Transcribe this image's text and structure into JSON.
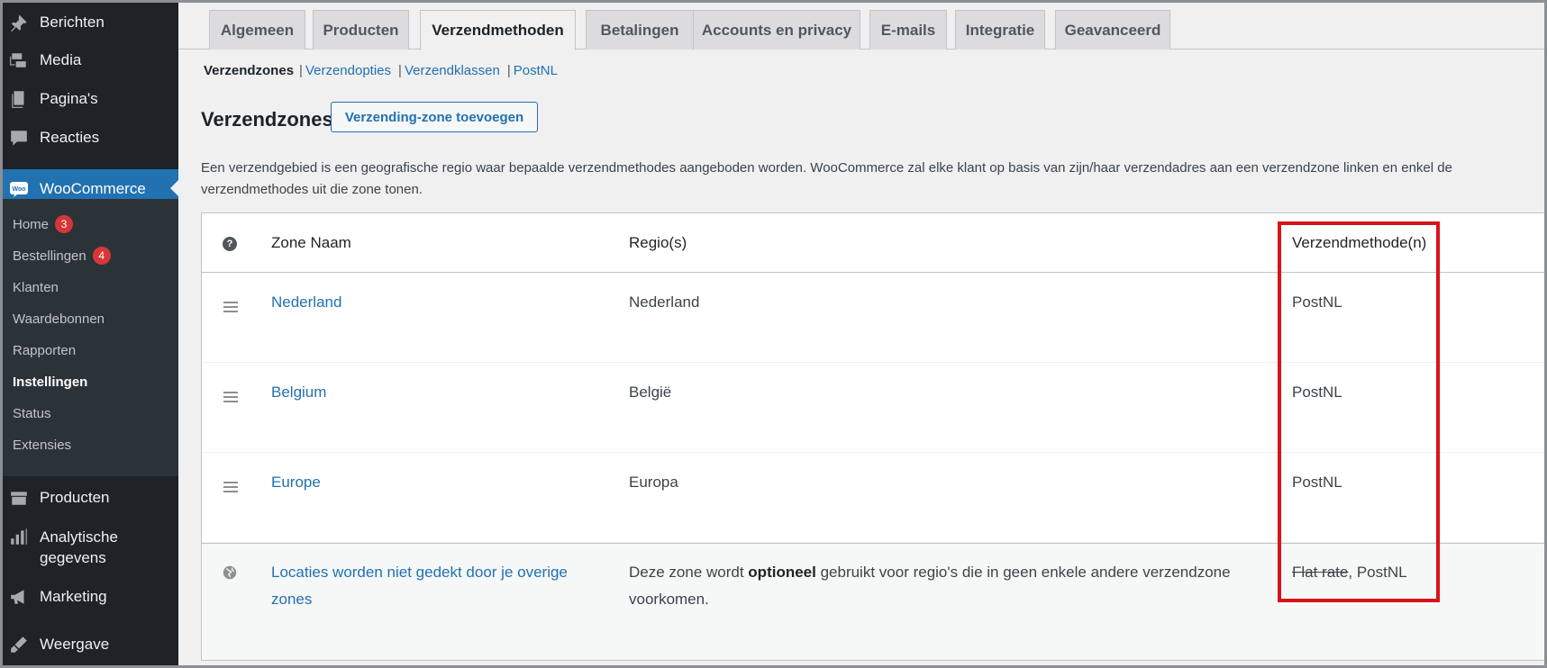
{
  "sidebar": {
    "items": [
      {
        "label": "Berichten",
        "icon": "pin-icon"
      },
      {
        "label": "Media",
        "icon": "media-icon"
      },
      {
        "label": "Pagina's",
        "icon": "pages-icon"
      },
      {
        "label": "Reacties",
        "icon": "comments-icon"
      },
      {
        "label": "WooCommerce",
        "icon": "woocommerce-icon"
      },
      {
        "label": "Producten",
        "icon": "products-icon"
      },
      {
        "label": "Analytische gegevens",
        "icon": "analytics-icon"
      },
      {
        "label": "Marketing",
        "icon": "megaphone-icon"
      },
      {
        "label": "Weergave",
        "icon": "appearance-icon"
      }
    ],
    "analytics_line1": "Analytische",
    "analytics_line2": "gegevens",
    "submenu": [
      {
        "label": "Home",
        "badge": "3"
      },
      {
        "label": "Bestellingen",
        "badge": "4"
      },
      {
        "label": "Klanten"
      },
      {
        "label": "Waardebonnen"
      },
      {
        "label": "Rapporten"
      },
      {
        "label": "Instellingen",
        "active": true
      },
      {
        "label": "Status"
      },
      {
        "label": "Extensies"
      }
    ]
  },
  "tabs": [
    {
      "label": "Algemeen"
    },
    {
      "label": "Producten"
    },
    {
      "label": "Verzendmethoden",
      "active": true
    },
    {
      "label": "Betalingen"
    },
    {
      "label": "Accounts en privacy"
    },
    {
      "label": "E-mails"
    },
    {
      "label": "Integratie"
    },
    {
      "label": "Geavanceerd"
    }
  ],
  "subsections": [
    {
      "label": "Verzendzones",
      "current": true
    },
    {
      "label": "Verzendopties"
    },
    {
      "label": "Verzendklassen"
    },
    {
      "label": "PostNL"
    }
  ],
  "separator": "|",
  "page": {
    "title": "Verzendzones",
    "add_button": "Verzending-zone toevoegen",
    "description": "Een verzendgebied is een geografische regio waar bepaalde verzendmethodes aangeboden worden. WooCommerce zal elke klant op basis van zijn/haar verzendadres aan een verzendzone linken en enkel de verzendmethodes uit die zone tonen."
  },
  "table": {
    "headers": {
      "help": "?",
      "zone": "Zone Naam",
      "regions": "Regio(s)",
      "methods": "Verzendmethode(n)"
    },
    "rows": [
      {
        "zone": "Nederland",
        "region": "Nederland",
        "methods": "PostNL"
      },
      {
        "zone": "Belgium",
        "region": "België",
        "methods": "PostNL"
      },
      {
        "zone": "Europe",
        "region": "Europa",
        "methods": "PostNL"
      }
    ],
    "fallback": {
      "zone": "Locaties worden niet gedekt door je overige zones",
      "region_prefix": "Deze zone wordt ",
      "region_bold": "optioneel",
      "region_suffix": " gebruikt voor regio's die in geen enkele andere verzendzone voorkomen.",
      "method_struck": "Flat rate",
      "method_sep": ", ",
      "method_active": "PostNL"
    }
  },
  "colors": {
    "accent": "#2271b1",
    "highlight": "#d7141a",
    "sidebar": "#1d2327",
    "badge": "#d63638"
  }
}
